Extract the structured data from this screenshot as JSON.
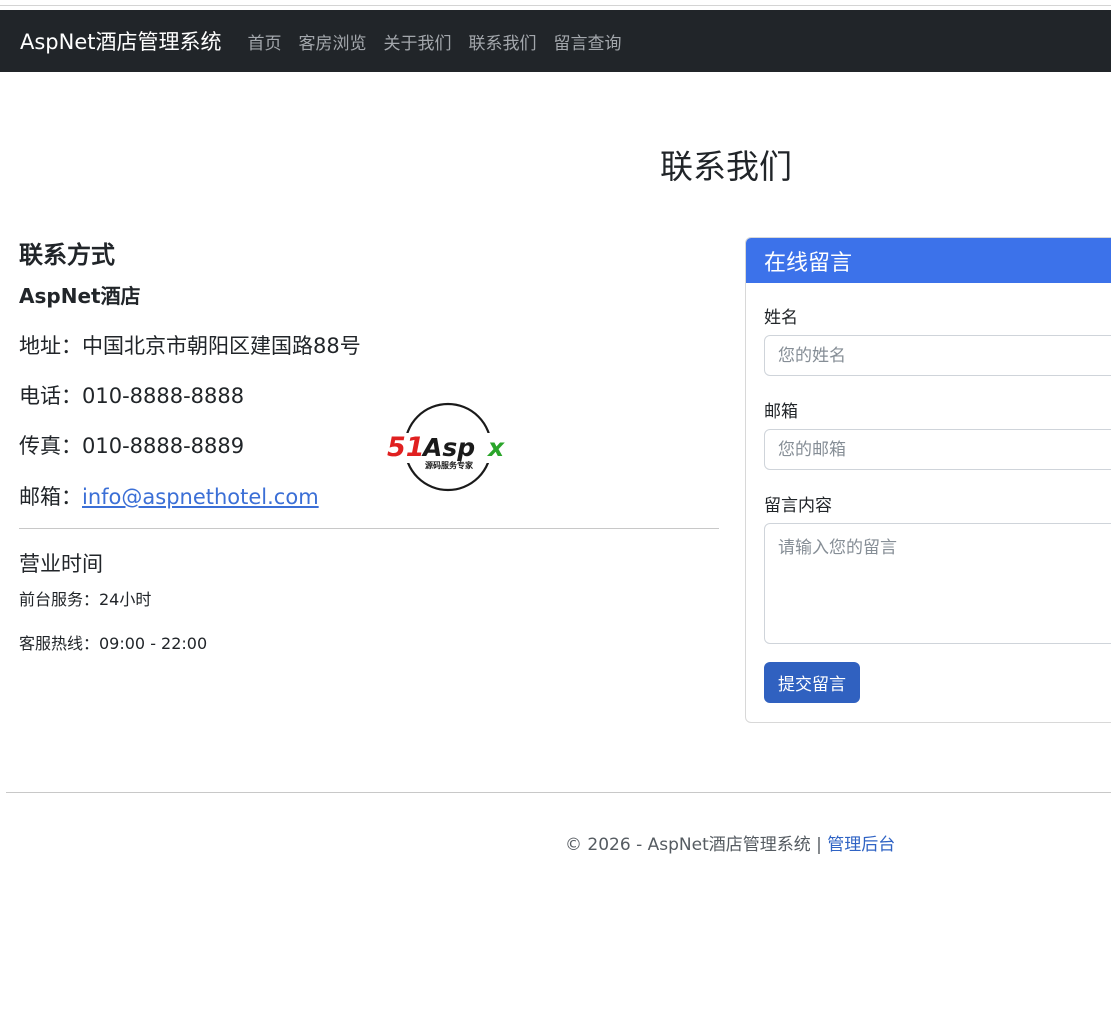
{
  "nav": {
    "brand": "AspNet酒店管理系统",
    "links": [
      "首页",
      "客房浏览",
      "关于我们",
      "联系我们",
      "留言查询"
    ]
  },
  "page": {
    "title": "联系我们"
  },
  "contact": {
    "heading": "联系方式",
    "hotel_name": "AspNet酒店",
    "address": "地址：中国北京市朝阳区建国路88号",
    "phone": "电话：010-8888-8888",
    "fax": "传真：010-8888-8889",
    "email_label": "邮箱：",
    "email": "info@aspnethotel.com"
  },
  "hours": {
    "heading": "营业时间",
    "front_desk": "前台服务：24小时",
    "hotline": "客服热线：09:00 - 22:00"
  },
  "logo": {
    "text": "51Aspx",
    "subtitle": "源码服务专家"
  },
  "form": {
    "title": "在线留言",
    "name_label": "姓名",
    "name_placeholder": "您的姓名",
    "email_label": "邮箱",
    "email_placeholder": "您的邮箱",
    "message_label": "留言内容",
    "message_placeholder": "请输入您的留言",
    "submit_label": "提交留言"
  },
  "footer": {
    "copyright": "© 2026 - AspNet酒店管理系统 | ",
    "admin_link": "管理后台"
  },
  "colors": {
    "navbar_bg": "#212529",
    "primary": "#3c72ea",
    "button": "#3061c0",
    "link": "#3b6fd6"
  }
}
